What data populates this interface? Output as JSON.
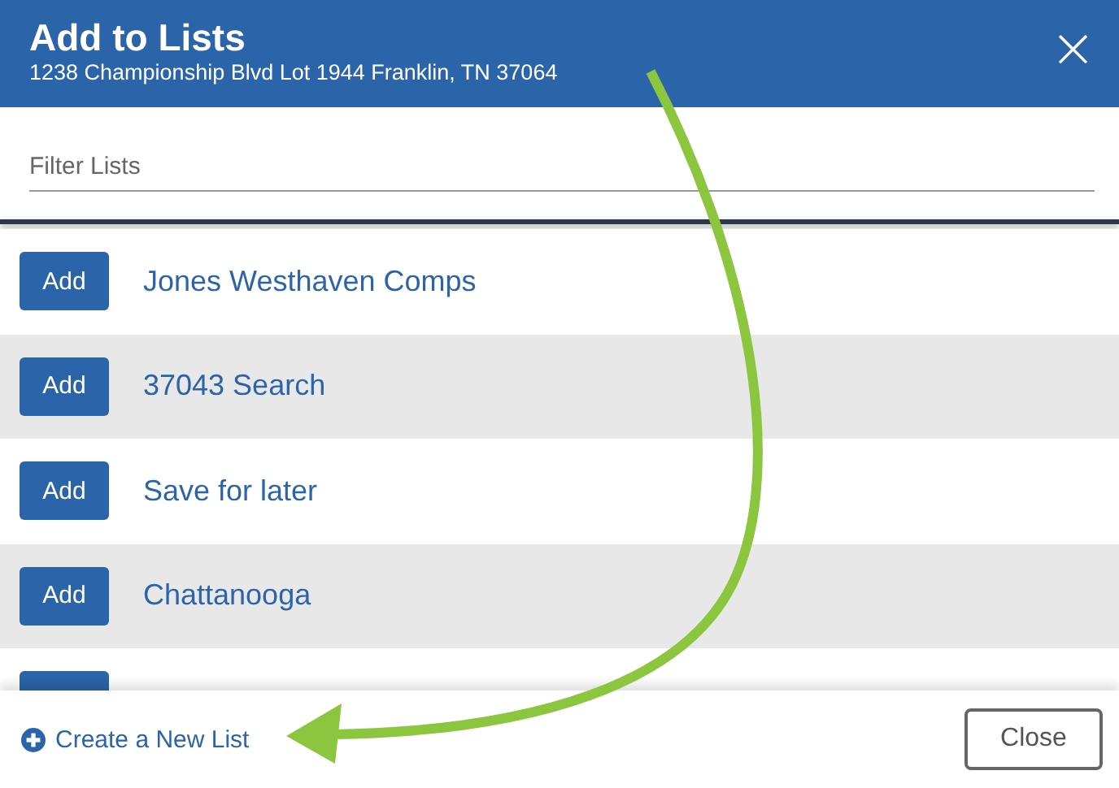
{
  "dialog": {
    "title": "Add to Lists",
    "subtitle": "1238 Championship Blvd Lot 1944 Franklin, TN 37064",
    "close_icon": "×"
  },
  "filter": {
    "placeholder": "Filter Lists"
  },
  "lists": [
    {
      "button": "Add",
      "name": "Jones Westhaven Comps"
    },
    {
      "button": "Add",
      "name": "37043 Search"
    },
    {
      "button": "Add",
      "name": "Save for later"
    },
    {
      "button": "Add",
      "name": "Chattanooga"
    }
  ],
  "more_rows_below": true,
  "footer": {
    "create_link": "Create a New List",
    "close_button": "Close"
  }
}
